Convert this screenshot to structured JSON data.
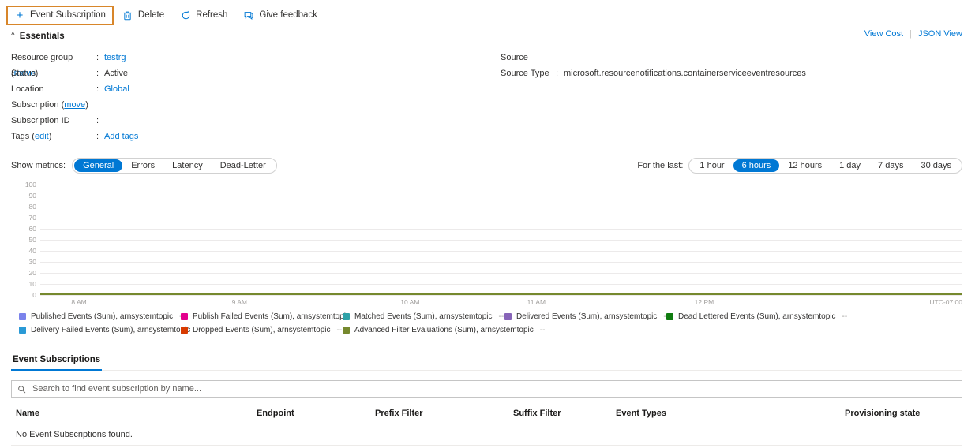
{
  "toolbar": {
    "items": [
      {
        "label": "Event Subscription",
        "icon": "plus-icon",
        "highlighted": true
      },
      {
        "label": "Delete",
        "icon": "trash-icon",
        "highlighted": false
      },
      {
        "label": "Refresh",
        "icon": "refresh-icon",
        "highlighted": false
      },
      {
        "label": "Give feedback",
        "icon": "feedback-icon",
        "highlighted": false
      }
    ]
  },
  "essentials": {
    "title": "Essentials",
    "view_cost": "View Cost",
    "json_view": "JSON View",
    "left_rows": [
      {
        "label": "Resource group",
        "sublink": "move",
        "colon": ":",
        "value": "testrg",
        "value_link": true
      },
      {
        "label": "Status",
        "sublink": "",
        "colon": ":",
        "value": "Active",
        "value_link": false
      },
      {
        "label": "Location",
        "sublink": "",
        "colon": ":",
        "value": "Global",
        "value_link": true
      },
      {
        "label": "Subscription",
        "sublink": "move",
        "colon": "",
        "value": "",
        "value_link": false
      },
      {
        "label": "Subscription ID",
        "sublink": "",
        "colon": ":",
        "value": "",
        "value_link": false
      },
      {
        "label": "Tags",
        "sublink": "edit",
        "colon": ":",
        "value": "Add tags",
        "value_link": true
      }
    ],
    "right_rows": [
      {
        "label": "Source",
        "colon": "",
        "value": ""
      },
      {
        "label": "Source Type",
        "colon": ":",
        "value": "microsoft.resourcenotifications.containerserviceeventresources"
      }
    ]
  },
  "metrics": {
    "show_metrics_label": "Show metrics:",
    "tabs": [
      {
        "label": "General",
        "active": true
      },
      {
        "label": "Errors",
        "active": false
      },
      {
        "label": "Latency",
        "active": false
      },
      {
        "label": "Dead-Letter",
        "active": false
      }
    ],
    "for_the_last_label": "For the last:",
    "ranges": [
      {
        "label": "1 hour",
        "active": false
      },
      {
        "label": "6 hours",
        "active": true
      },
      {
        "label": "12 hours",
        "active": false
      },
      {
        "label": "1 day",
        "active": false
      },
      {
        "label": "7 days",
        "active": false
      },
      {
        "label": "30 days",
        "active": false
      }
    ]
  },
  "chart_data": {
    "type": "line",
    "title": "",
    "xlabel": "",
    "ylabel": "",
    "ylim": [
      0,
      100
    ],
    "yticks": [
      100,
      90,
      80,
      70,
      60,
      50,
      40,
      30,
      20,
      10,
      0
    ],
    "grid": true,
    "legend_position": "bottom",
    "timezone": "UTC-07:00",
    "x_tick_labels": [
      "8 AM",
      "9 AM",
      "10 AM",
      "11 AM",
      "12 PM"
    ],
    "x_tick_positions_pct": [
      4.2,
      21.6,
      40.1,
      53.8,
      72.0
    ],
    "series": [
      {
        "name": "Published Events (Sum), arnsystemtopic",
        "value": "--",
        "color": "#7b83eb",
        "values": [
          0,
          0,
          0,
          0,
          0
        ]
      },
      {
        "name": "Publish Failed Events (Sum), arnsystemtopic",
        "value": "--",
        "color": "#e3008c",
        "values": [
          0,
          0,
          0,
          0,
          0
        ]
      },
      {
        "name": "Matched Events (Sum), arnsystemtopic",
        "value": "--",
        "color": "#30a2a8",
        "values": [
          0,
          0,
          0,
          0,
          0
        ]
      },
      {
        "name": "Delivered Events (Sum), arnsystemtopic",
        "value": "--",
        "color": "#8764b8",
        "values": [
          0,
          0,
          0,
          0,
          0
        ]
      },
      {
        "name": "Dead Lettered Events (Sum), arnsystemtopic",
        "value": "--",
        "color": "#107c10",
        "values": [
          0,
          0,
          0,
          0,
          0
        ]
      },
      {
        "name": "Delivery Failed Events (Sum), arnsystemtopic",
        "value": "--",
        "color": "#2a9ad6",
        "values": [
          0,
          0,
          0,
          0,
          0
        ]
      },
      {
        "name": "Dropped Events (Sum), arnsystemtopic",
        "value": "--",
        "color": "#d83b01",
        "values": [
          0,
          0,
          0,
          0,
          0
        ]
      },
      {
        "name": "Advanced Filter Evaluations (Sum), arnsystemtopic",
        "value": "--",
        "color": "#76892e",
        "values": [
          0,
          0,
          0,
          0,
          0
        ]
      }
    ]
  },
  "subscriptions": {
    "tab_label": "Event Subscriptions",
    "search_placeholder": "Search to find event subscription by name...",
    "search_value": "",
    "columns": [
      "Name",
      "Endpoint",
      "Prefix Filter",
      "Suffix Filter",
      "Event Types",
      "Provisioning state"
    ],
    "empty_message": "No Event Subscriptions found.",
    "rows": []
  }
}
